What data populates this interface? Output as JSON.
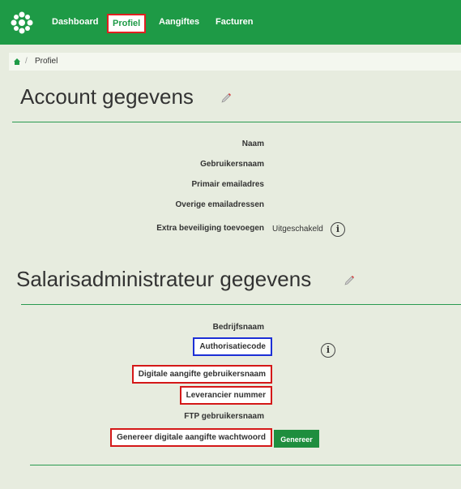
{
  "nav": {
    "logo_icon": "logo-icon",
    "items": [
      {
        "label": "Dashboard"
      },
      {
        "label": "Profiel"
      },
      {
        "label": "Aangiftes"
      },
      {
        "label": "Facturen"
      }
    ]
  },
  "breadcrumb": {
    "home_icon": "home-icon",
    "separator": "/",
    "current": "Profiel"
  },
  "account": {
    "title": "Account gegevens",
    "edit_icon": "pencil-icon",
    "fields": {
      "naam": "Naam",
      "gebruikersnaam": "Gebruikersnaam",
      "primair_email": "Primair emailadres",
      "overige_email": "Overige emailadressen",
      "extra_beveiliging": "Extra beveiliging toevoegen",
      "extra_beveiliging_value": "Uitgeschakeld"
    }
  },
  "salaris": {
    "title": "Salarisadministrateur gegevens",
    "edit_icon": "pencil-icon",
    "fields": {
      "bedrijfsnaam": "Bedrijfsnaam",
      "authorisatiecode": "Authorisatiecode",
      "digitale_aangifte_gebruikersnaam": "Digitale aangifte gebruikersnaam",
      "leverancier_nummer": "Leverancier nummer",
      "ftp_gebruikersnaam": "FTP gebruikersnaam",
      "genereer_wachtwoord": "Genereer digitale aangifte wachtwoord"
    },
    "generate_button": "Genereer"
  },
  "colors": {
    "brand_green": "#1e9a46",
    "highlight_red": "#d41818",
    "highlight_blue": "#1c2fd6"
  }
}
